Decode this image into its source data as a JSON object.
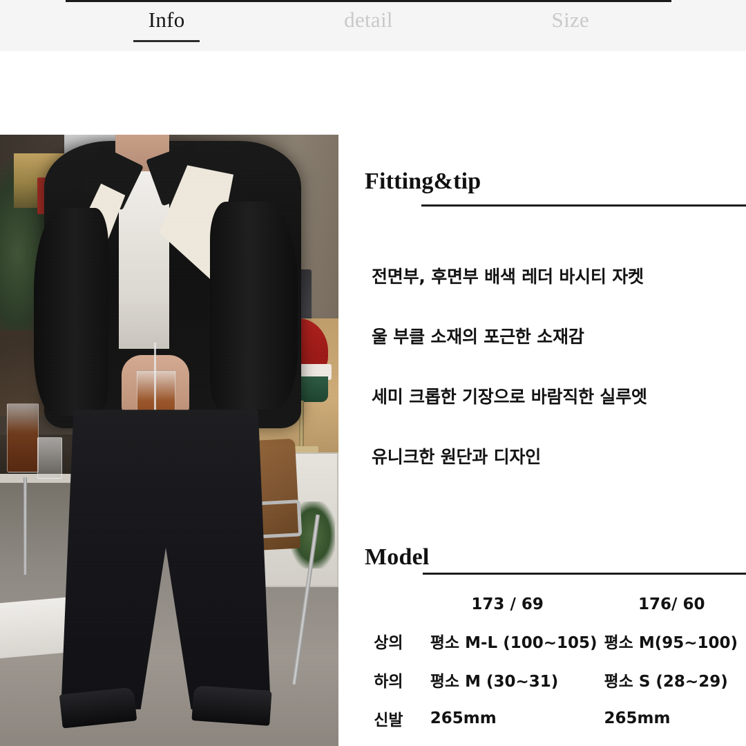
{
  "tabs": [
    {
      "label": "Info",
      "active": true
    },
    {
      "label": "detail",
      "active": false
    },
    {
      "label": "Size",
      "active": false
    }
  ],
  "product_photo": {
    "alt": "Model wearing black wool boucle varsity jacket with cream panels, black wide jeans and black leather shoes in a cafe"
  },
  "fitting": {
    "title": "Fitting&tip",
    "points": [
      "전면부, 후면부 배색 레더 바시티 자켓",
      "울 부클 소재의 포근한 소재감",
      "세미 크롭한 기장으로 바람직한 실루엣",
      "유니크한 원단과 디자인"
    ]
  },
  "model": {
    "title": "Model",
    "header": {
      "label": "",
      "model_a": "173 / 69",
      "model_b": "176/ 60"
    },
    "rows": [
      {
        "label": "상의",
        "model_a": "평소 M-L (100~105)",
        "model_b": "평소 M(95~100)"
      },
      {
        "label": "하의",
        "model_a": "평소 M (30~31)",
        "model_b": "평소 S (28~29)"
      },
      {
        "label": "신발",
        "model_a": "265mm",
        "model_b": "265mm"
      }
    ]
  },
  "colors": {
    "tabbar_bg": "#f5f5f5",
    "active_tab": "#141414",
    "inactive_tab": "#c9c9c9",
    "rule": "#1c1c1c",
    "body_text": "#121212",
    "page_bg": "#ffffff"
  }
}
